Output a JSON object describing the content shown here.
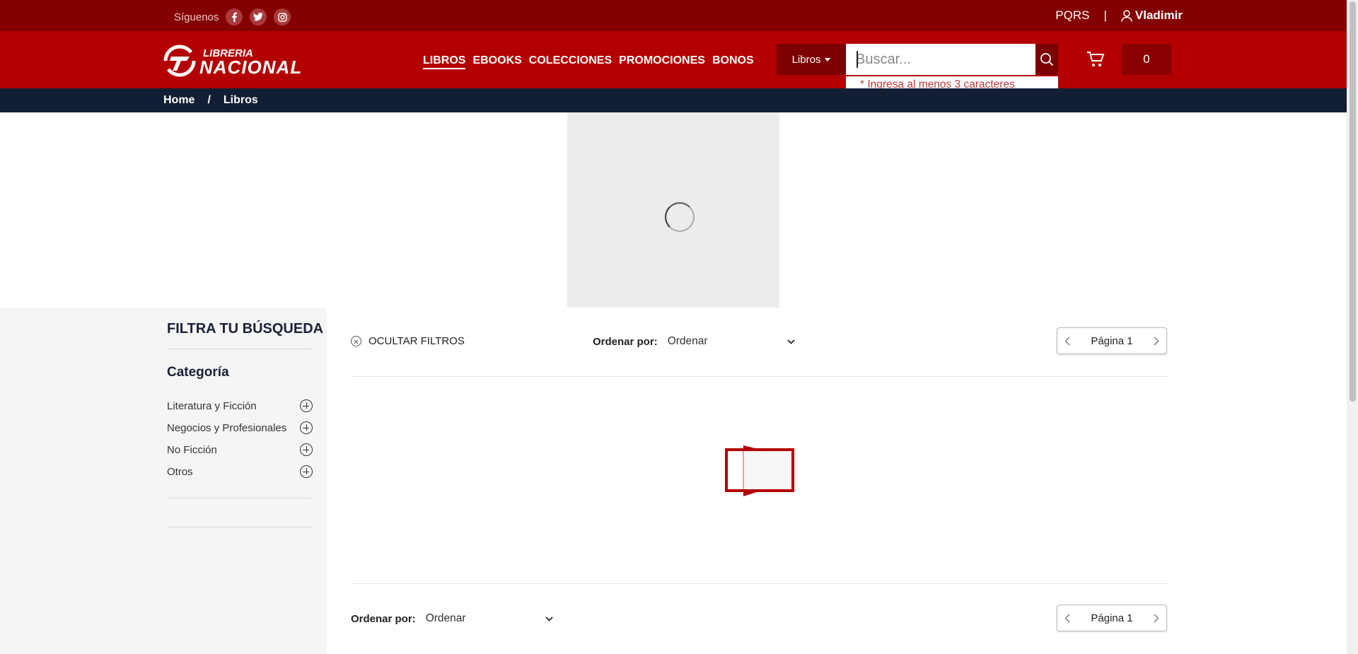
{
  "topbar": {
    "follow_label": "Síguenos",
    "social": [
      "facebook-icon",
      "twitter-icon",
      "instagram-icon"
    ],
    "pqrs": "PQRS",
    "separator": "|",
    "user_name": "Vladimir"
  },
  "header": {
    "logo_top": "LIBRERIA",
    "logo_bottom": "NACIONAL",
    "nav": [
      "LIBROS",
      "EBOOKS",
      "COLECCIONES",
      "PROMOCIONES",
      "BONOS"
    ],
    "search_category": "Libros",
    "search_placeholder": "Buscar...",
    "search_message": "* Ingresa al menos 3 caracteres",
    "cart_count": "0"
  },
  "breadcrumb": {
    "home": "Home",
    "separator": "/",
    "current": "Libros"
  },
  "sidebar": {
    "title": "FILTRA TU BÚSQUEDA",
    "category_title": "Categoría",
    "categories": [
      "Literatura y Ficción",
      "Negocios y Profesionales",
      "No Ficción",
      "Otros"
    ]
  },
  "main": {
    "hide_filters": "OCULTAR FILTROS",
    "sort_label": "Ordenar por:",
    "sort_value": "Ordenar",
    "page_label": "Página 1"
  },
  "colors": {
    "topbar": "#840000",
    "header": "#b30000",
    "breadcrumb": "#121e33",
    "accent": "#c03a3a"
  }
}
